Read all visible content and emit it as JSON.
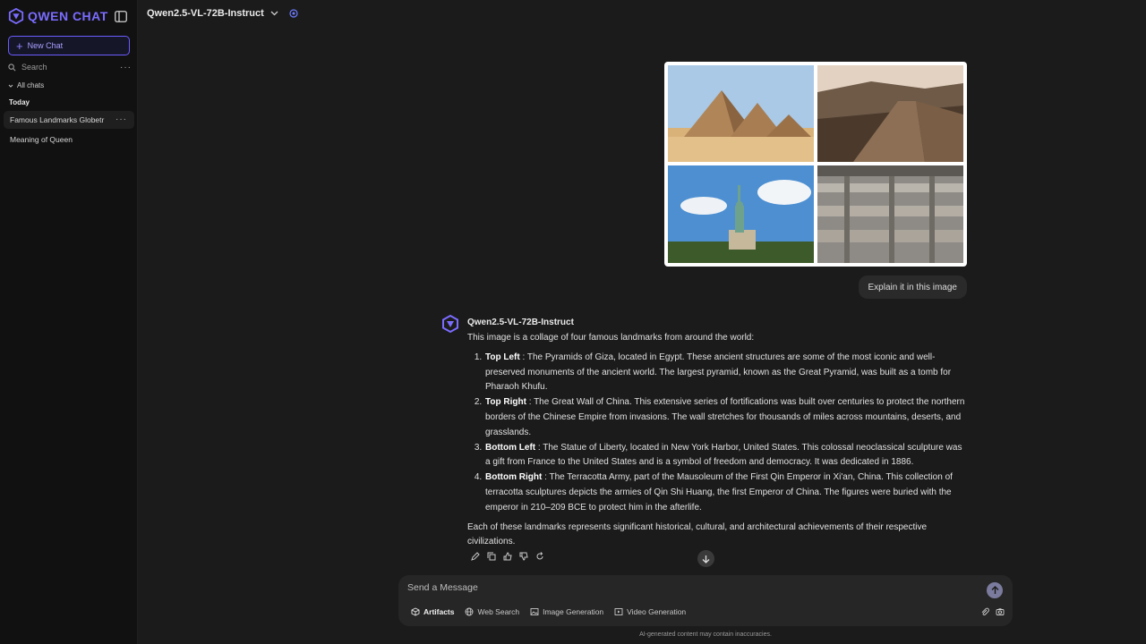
{
  "sidebar": {
    "brand": "QWEN CHAT",
    "new_chat_label": "New Chat",
    "search_label": "Search",
    "all_chats_label": "All chats",
    "section_today": "Today",
    "chats": [
      {
        "title": "Famous Landmarks Globetr"
      },
      {
        "title": "Meaning of Queen"
      }
    ]
  },
  "header": {
    "model_name": "Qwen2.5-VL-72B-Instruct"
  },
  "conversation": {
    "user_message": "Explain it in this image",
    "assistant_name": "Qwen2.5-VL-72B-Instruct",
    "intro": "This image is a collage of four famous landmarks from around the world:",
    "items": [
      {
        "heading": "Top Left",
        "text": " : The Pyramids of Giza, located in Egypt. These ancient structures are some of the most iconic and well-preserved monuments of the ancient world. The largest pyramid, known as the Great Pyramid, was built as a tomb for Pharaoh Khufu."
      },
      {
        "heading": "Top Right",
        "text": " : The Great Wall of China. This extensive series of fortifications was built over centuries to protect the northern borders of the Chinese Empire from invasions. The wall stretches for thousands of miles across mountains, deserts, and grasslands."
      },
      {
        "heading": "Bottom Left",
        "text": " : The Statue of Liberty, located in New York Harbor, United States. This colossal neoclassical sculpture was a gift from France to the United States and is a symbol of freedom and democracy. It was dedicated in 1886."
      },
      {
        "heading": "Bottom Right",
        "text": " : The Terracotta Army, part of the Mausoleum of the First Qin Emperor in Xi'an, China. This collection of terracotta sculptures depicts the armies of Qin Shi Huang, the first Emperor of China. The figures were buried with the emperor in 210–209 BCE to protect him in the afterlife."
      }
    ],
    "outro": "Each of these landmarks represents significant historical, cultural, and architectural achievements of their respective civilizations."
  },
  "composer": {
    "placeholder": "Send a Message",
    "tools": [
      {
        "label": "Artifacts",
        "icon": "cube-icon"
      },
      {
        "label": "Web Search",
        "icon": "globe-icon"
      },
      {
        "label": "Image Generation",
        "icon": "image-icon"
      },
      {
        "label": "Video Generation",
        "icon": "video-icon"
      }
    ],
    "disclaimer": "AI-generated content may contain inaccuracies."
  },
  "colors": {
    "accent": "#7a6cff",
    "background": "#1b1b1b",
    "sidebar": "#111111"
  }
}
